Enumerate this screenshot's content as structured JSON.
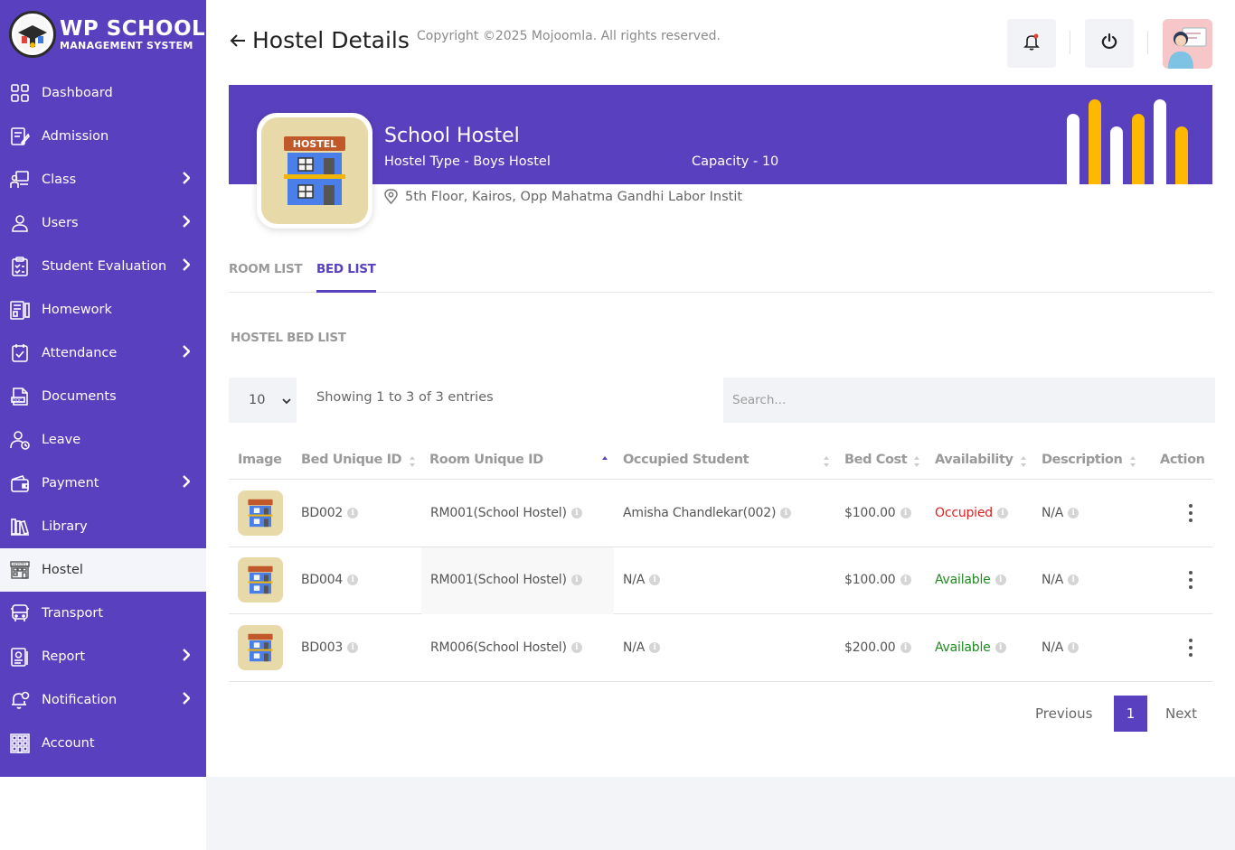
{
  "brand": {
    "title": "WP SCHOOL",
    "subtitle": "MANAGEMENT SYSTEM"
  },
  "sidebar": {
    "items": [
      {
        "label": "Dashboard",
        "icon": "dashboard-icon",
        "has_submenu": false
      },
      {
        "label": "Admission",
        "icon": "admission-icon",
        "has_submenu": false
      },
      {
        "label": "Class",
        "icon": "class-icon",
        "has_submenu": true
      },
      {
        "label": "Users",
        "icon": "users-icon",
        "has_submenu": true
      },
      {
        "label": "Student Evaluation",
        "icon": "evaluation-icon",
        "has_submenu": true
      },
      {
        "label": "Homework",
        "icon": "homework-icon",
        "has_submenu": false
      },
      {
        "label": "Attendance",
        "icon": "attendance-icon",
        "has_submenu": true
      },
      {
        "label": "Documents",
        "icon": "documents-icon",
        "has_submenu": false
      },
      {
        "label": "Leave",
        "icon": "leave-icon",
        "has_submenu": false
      },
      {
        "label": "Payment",
        "icon": "payment-icon",
        "has_submenu": true
      },
      {
        "label": "Library",
        "icon": "library-icon",
        "has_submenu": false
      },
      {
        "label": "Hostel",
        "icon": "hostel-icon",
        "has_submenu": false,
        "active": true
      },
      {
        "label": "Transport",
        "icon": "transport-icon",
        "has_submenu": false
      },
      {
        "label": "Report",
        "icon": "report-icon",
        "has_submenu": true
      },
      {
        "label": "Notification",
        "icon": "notification-icon",
        "has_submenu": true
      },
      {
        "label": "Account",
        "icon": "account-icon",
        "has_submenu": false
      }
    ]
  },
  "header": {
    "title": "Hostel Details"
  },
  "hostel": {
    "name": "School Hostel",
    "type": "Hostel Type - Boys Hostel",
    "capacity": "Capacity - 10",
    "address": "5th Floor, Kairos, Opp Mahatma Gandhi Labor Instit",
    "image_label": "HOSTEL"
  },
  "tabs": [
    {
      "label": "ROOM LIST",
      "active": false
    },
    {
      "label": "BED LIST",
      "active": true
    }
  ],
  "section_title": "HOSTEL BED LIST",
  "table_controls": {
    "page_length": "10",
    "entries_info": "Showing 1 to 3 of 3 entries",
    "search_placeholder": "Search..."
  },
  "table": {
    "columns": [
      "Image",
      "Bed Unique ID",
      "Room Unique ID",
      "Occupied Student",
      "Bed Cost",
      "Availability",
      "Description",
      "Action"
    ],
    "rows": [
      {
        "bed_id": "BD002",
        "room_id": "RM001(School Hostel)",
        "student": "Amisha Chandlekar(002)",
        "cost": "$100.00",
        "availability": "Occupied",
        "description": "N/A"
      },
      {
        "bed_id": "BD004",
        "room_id": "RM001(School Hostel)",
        "student": "N/A",
        "cost": "$100.00",
        "availability": "Available",
        "description": "N/A"
      },
      {
        "bed_id": "BD003",
        "room_id": "RM006(School Hostel)",
        "student": "N/A",
        "cost": "$200.00",
        "availability": "Available",
        "description": "N/A"
      }
    ]
  },
  "pagination": {
    "previous": "Previous",
    "current": "1",
    "next": "Next"
  },
  "footer": {
    "copyright": "Copyright ©2025 Mojoomla. All rights reserved."
  },
  "colors": {
    "primary": "#5940be",
    "accent_yellow": "#ffb800",
    "occupied": "#e01f1f",
    "available": "#1f8a1f"
  }
}
